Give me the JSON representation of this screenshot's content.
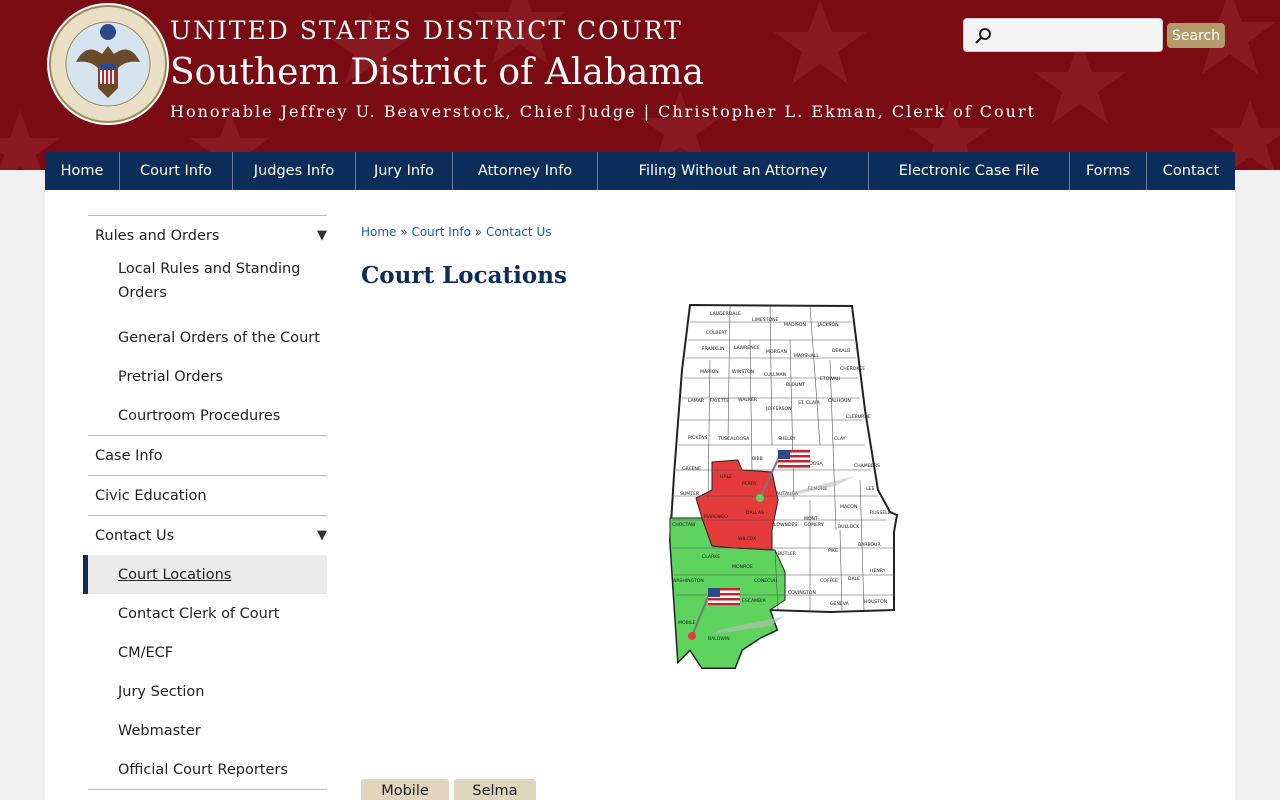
{
  "header": {
    "court": "UNITED STATES DISTRICT COURT",
    "district": "Southern District of Alabama",
    "judges": "Honorable Jeffrey U. Beaverstock, Chief Judge  |  Christopher L. Ekman, Clerk of Court",
    "search_placeholder": "",
    "search_button": "Search",
    "seal_text": "UNITED STATES DISTRICT COURT · SOUTHERN DISTRICT OF ALABAMA"
  },
  "nav": [
    {
      "label": "Home"
    },
    {
      "label": "Court Info"
    },
    {
      "label": "Judges Info"
    },
    {
      "label": "Jury Info"
    },
    {
      "label": "Attorney Info"
    },
    {
      "label": "Filing Without an Attorney"
    },
    {
      "label": "Electronic Case File"
    },
    {
      "label": "Forms"
    },
    {
      "label": "Contact"
    }
  ],
  "sidebar": {
    "rules": "Rules and Orders",
    "local_rules": "Local Rules and Standing Orders",
    "general_orders": "General Orders of the Court",
    "pretrial": "Pretrial Orders",
    "courtroom": "Courtroom Procedures",
    "case_info": "Case Info",
    "civic": "Civic Education",
    "contact": "Contact Us",
    "locations": "Court Locations",
    "clerk": "Contact Clerk of Court",
    "cmecf": "CM/ECF",
    "jury": "Jury Section",
    "webmaster": "Webmaster",
    "reporters": "Official Court Reporters"
  },
  "breadcrumb": {
    "home": "Home",
    "court_info": "Court Info",
    "contact": "Contact Us",
    "sep": "»"
  },
  "page": {
    "title": "Court Locations"
  },
  "map": {
    "northern_counties": [
      "LAUDERDALE",
      "LIMESTONE",
      "MADISON",
      "JACKSON",
      "COLBERT",
      "FRANKLIN",
      "LAWRENCE",
      "MORGAN",
      "MARSHALL",
      "DEKALB",
      "MARION",
      "WINSTON",
      "CULLMAN",
      "ETOWAH",
      "CHEROKEE",
      "BLOUNT",
      "LAMAR",
      "FAYETTE",
      "WALKER",
      "ST. CLAIR",
      "CALHOUN",
      "JEFFERSON",
      "CLEBURNE",
      "PICKENS",
      "TUSCALOOSA",
      "SHELBY",
      "TALLADEGA",
      "CLAY",
      "RANDOLPH",
      "GREENE",
      "BIBB",
      "COOSA",
      "TALLAPOOSA",
      "CHAMBERS",
      "SUMTER",
      "AUTAUGA",
      "ELMORE",
      "LEE",
      "LOWNDES",
      "MONTGOMERY",
      "MACON",
      "RUSSELL",
      "BUTLER",
      "CRENSHAW",
      "BULLOCK",
      "BARBOUR",
      "PIKE",
      "COFFEE",
      "DALE",
      "HENRY",
      "COVINGTON",
      "GENEVA",
      "HOUSTON"
    ],
    "selma_counties": [
      "HALE",
      "PERRY",
      "MARENGO",
      "DALLAS",
      "WILCOX"
    ],
    "mobile_counties": [
      "CHOCTAW",
      "CLARKE",
      "MONROE",
      "WASHINGTON",
      "CONECUH",
      "ESCAMBIA",
      "MOBILE",
      "BALDWIN"
    ],
    "colors": {
      "selma": "#e53b3b",
      "mobile": "#5ed35e",
      "other": "#ffffff"
    }
  },
  "tabs": [
    {
      "label": "Mobile"
    },
    {
      "label": "Selma"
    }
  ]
}
